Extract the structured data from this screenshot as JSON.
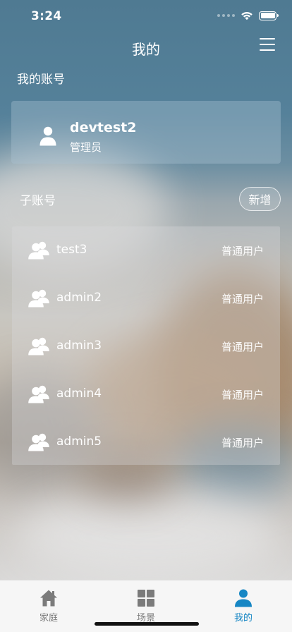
{
  "status_bar": {
    "time": "3:24"
  },
  "header": {
    "title": "我的",
    "menu_icon": "hamburger-icon"
  },
  "my_account": {
    "section_title": "我的账号",
    "username": "devtest2",
    "role": "管理员",
    "avatar_icon": "user-icon"
  },
  "sub_accounts": {
    "section_title": "子账号",
    "add_label": "新增",
    "items": [
      {
        "name": "test3",
        "type": "普通用户"
      },
      {
        "name": "admin2",
        "type": "普通用户"
      },
      {
        "name": "admin3",
        "type": "普通用户"
      },
      {
        "name": "admin4",
        "type": "普通用户"
      },
      {
        "name": "admin5",
        "type": "普通用户"
      }
    ]
  },
  "tab_bar": {
    "active_color": "#1686c4",
    "inactive_color": "#7b7b7b",
    "tabs": [
      {
        "label": "家庭",
        "icon": "home-icon"
      },
      {
        "label": "场景",
        "icon": "grid-icon"
      },
      {
        "label": "我的",
        "icon": "user-icon",
        "active": true
      }
    ]
  }
}
